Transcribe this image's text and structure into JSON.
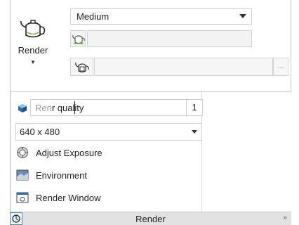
{
  "panel": {
    "render_button_label": "Render",
    "preset_value": "Medium",
    "row2_value": "",
    "row3_value": "",
    "row3_more": "..."
  },
  "dropdown": {
    "quality_label_dim": "Ren",
    "quality_label_rest": "r quality",
    "quality_value": "1",
    "size_value": "640 x 480",
    "items": [
      {
        "label": "Adjust Exposure",
        "icon": "adjust-exposure-icon"
      },
      {
        "label": "Environment",
        "icon": "environment-icon"
      },
      {
        "label": "Render Window",
        "icon": "render-window-icon"
      }
    ]
  },
  "footer": {
    "title": "Render",
    "expand": "»"
  }
}
